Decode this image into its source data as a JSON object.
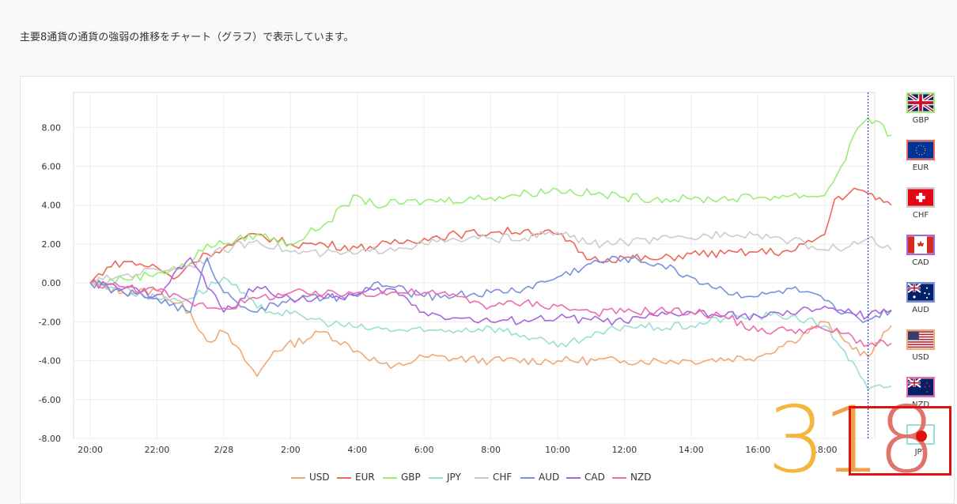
{
  "intro_text": "主要8通貨の通貨の強弱の推移をチャート（グラフ）で表示しています。",
  "chart_data": {
    "type": "line",
    "title": "",
    "xlabel": "",
    "ylabel": "",
    "x_ticks": [
      "20:00",
      "22:00",
      "2/28",
      "2:00",
      "4:00",
      "6:00",
      "8:00",
      "10:00",
      "12:00",
      "14:00",
      "16:00",
      "18:00"
    ],
    "y_ticks": [
      "8.00",
      "6.00",
      "4.00",
      "2.00",
      "0.00",
      "-2.00",
      "-4.00",
      "-6.00",
      "-8.00"
    ],
    "ylim": [
      -8,
      9.8
    ],
    "x_range_hours": [
      -0.5,
      23.5
    ],
    "current_time_marker_hour": 23.3,
    "grid": true,
    "legend_position": "bottom",
    "series": [
      {
        "name": "USD",
        "color": "#f0a875",
        "points": [
          [
            0,
            0
          ],
          [
            1,
            -0.5
          ],
          [
            2,
            -0.4
          ],
          [
            3,
            -1.5
          ],
          [
            3.5,
            -3.0
          ],
          [
            4,
            -2.5
          ],
          [
            5,
            -4.8
          ],
          [
            5.5,
            -3.5
          ],
          [
            7,
            -2.5
          ],
          [
            8,
            -3.5
          ],
          [
            9,
            -4.4
          ],
          [
            10,
            -3.8
          ],
          [
            12,
            -4.0
          ],
          [
            14,
            -4.0
          ],
          [
            16,
            -4.0
          ],
          [
            18,
            -4.0
          ],
          [
            20,
            -3.8
          ],
          [
            21,
            -3.0
          ],
          [
            22,
            -2.0
          ],
          [
            22.6,
            -3.0
          ],
          [
            23.3,
            -3.8
          ],
          [
            24,
            -2.2
          ]
        ]
      },
      {
        "name": "EUR",
        "color": "#ee6655",
        "points": [
          [
            0,
            0
          ],
          [
            0.5,
            0.8
          ],
          [
            1,
            1.1
          ],
          [
            2,
            0.8
          ],
          [
            2.5,
            0.2
          ],
          [
            3,
            1.0
          ],
          [
            3.5,
            1.5
          ],
          [
            4,
            1.8
          ],
          [
            5,
            2.5
          ],
          [
            6,
            2.0
          ],
          [
            7,
            2.0
          ],
          [
            8,
            1.8
          ],
          [
            9,
            2.0
          ],
          [
            10,
            2.3
          ],
          [
            11,
            2.5
          ],
          [
            12,
            2.6
          ],
          [
            13,
            2.7
          ],
          [
            14,
            2.5
          ],
          [
            15,
            1.2
          ],
          [
            16,
            1.3
          ],
          [
            17,
            1.2
          ],
          [
            18,
            1.5
          ],
          [
            19,
            1.5
          ],
          [
            20,
            1.6
          ],
          [
            21,
            1.6
          ],
          [
            22,
            2.5
          ],
          [
            22.3,
            4.3
          ],
          [
            23,
            4.8
          ],
          [
            23.3,
            4.6
          ],
          [
            24,
            4.0
          ]
        ]
      },
      {
        "name": "GBP",
        "color": "#99ee77",
        "points": [
          [
            0,
            0
          ],
          [
            1,
            0.2
          ],
          [
            2,
            0.5
          ],
          [
            3,
            1.0
          ],
          [
            3.5,
            2.0
          ],
          [
            4,
            2.0
          ],
          [
            5,
            2.5
          ],
          [
            6,
            2.0
          ],
          [
            7,
            3.0
          ],
          [
            8,
            4.5
          ],
          [
            8.5,
            4.0
          ],
          [
            10,
            4.2
          ],
          [
            12,
            4.4
          ],
          [
            14,
            4.8
          ],
          [
            16,
            4.4
          ],
          [
            18,
            4.3
          ],
          [
            20,
            4.4
          ],
          [
            21,
            4.5
          ],
          [
            22,
            4.5
          ],
          [
            22.5,
            6.0
          ],
          [
            23,
            8.0
          ],
          [
            23.3,
            8.5
          ],
          [
            24,
            7.6
          ]
        ]
      },
      {
        "name": "JPY",
        "color": "#99dfd4",
        "points": [
          [
            0,
            0
          ],
          [
            1,
            -0.3
          ],
          [
            2,
            -0.8
          ],
          [
            3,
            -0.8
          ],
          [
            4,
            0.3
          ],
          [
            5,
            -1.3
          ],
          [
            6,
            -1.6
          ],
          [
            7,
            -2.0
          ],
          [
            8,
            -2.3
          ],
          [
            10,
            -2.5
          ],
          [
            12,
            -2.3
          ],
          [
            13,
            -2.7
          ],
          [
            14,
            -3.3
          ],
          [
            15,
            -2.8
          ],
          [
            16,
            -2.2
          ],
          [
            17,
            -2.3
          ],
          [
            18,
            -2.2
          ],
          [
            19,
            -1.8
          ],
          [
            20,
            -1.7
          ],
          [
            21,
            -1.7
          ],
          [
            22,
            -2.2
          ],
          [
            22.6,
            -3.5
          ],
          [
            23.3,
            -5.5
          ],
          [
            24,
            -5.3
          ]
        ]
      },
      {
        "name": "CHF",
        "color": "#cccccc",
        "points": [
          [
            0,
            0
          ],
          [
            1,
            0.4
          ],
          [
            2,
            0.7
          ],
          [
            3,
            0.9
          ],
          [
            4,
            1.7
          ],
          [
            5,
            2.2
          ],
          [
            6,
            1.6
          ],
          [
            7,
            1.5
          ],
          [
            8,
            1.5
          ],
          [
            9,
            1.8
          ],
          [
            10,
            2.0
          ],
          [
            11,
            2.2
          ],
          [
            12,
            2.3
          ],
          [
            13,
            2.3
          ],
          [
            14,
            2.6
          ],
          [
            15,
            2.0
          ],
          [
            16,
            2.1
          ],
          [
            17,
            2.2
          ],
          [
            18,
            2.3
          ],
          [
            19,
            2.6
          ],
          [
            20,
            2.5
          ],
          [
            21,
            2.2
          ],
          [
            22,
            1.7
          ],
          [
            23,
            2.0
          ],
          [
            23.3,
            2.3
          ],
          [
            24,
            1.7
          ]
        ]
      },
      {
        "name": "AUD",
        "color": "#7b8fdc",
        "points": [
          [
            0,
            0
          ],
          [
            1,
            -0.5
          ],
          [
            2,
            -0.8
          ],
          [
            3,
            -1.5
          ],
          [
            3.5,
            1.3
          ],
          [
            4,
            -0.5
          ],
          [
            5,
            -1.5
          ],
          [
            6,
            -0.8
          ],
          [
            7,
            -0.8
          ],
          [
            8,
            -0.7
          ],
          [
            8.5,
            0.0
          ],
          [
            9,
            -0.2
          ],
          [
            10,
            -0.7
          ],
          [
            11,
            -0.6
          ],
          [
            12,
            -0.5
          ],
          [
            13,
            -0.3
          ],
          [
            14,
            0.3
          ],
          [
            15,
            1.0
          ],
          [
            16,
            1.3
          ],
          [
            17,
            1.0
          ],
          [
            18,
            0.3
          ],
          [
            19,
            -0.4
          ],
          [
            20,
            -0.7
          ],
          [
            21,
            -0.3
          ],
          [
            22,
            -0.9
          ],
          [
            22.5,
            -1.6
          ],
          [
            23,
            -1.8
          ],
          [
            23.3,
            -1.9
          ],
          [
            24,
            -1.4
          ]
        ]
      },
      {
        "name": "CAD",
        "color": "#a866dd",
        "points": [
          [
            0,
            0
          ],
          [
            1,
            -0.3
          ],
          [
            2,
            -0.6
          ],
          [
            3,
            1.3
          ],
          [
            4,
            -1.5
          ],
          [
            5,
            -0.2
          ],
          [
            6,
            -0.8
          ],
          [
            7,
            -0.8
          ],
          [
            8,
            -0.6
          ],
          [
            9,
            -0.3
          ],
          [
            10,
            -1.5
          ],
          [
            11,
            -1.8
          ],
          [
            12,
            -2.0
          ],
          [
            13,
            -1.9
          ],
          [
            14,
            -1.8
          ],
          [
            15,
            -1.9
          ],
          [
            16,
            -2.0
          ],
          [
            17,
            -1.7
          ],
          [
            18,
            -1.5
          ],
          [
            19,
            -1.7
          ],
          [
            20,
            -1.7
          ],
          [
            21,
            -1.6
          ],
          [
            22,
            -1.2
          ],
          [
            22.6,
            -1.5
          ],
          [
            23.3,
            -1.7
          ],
          [
            24,
            -1.4
          ]
        ]
      },
      {
        "name": "NZD",
        "color": "#ee6bb0",
        "points": [
          [
            0,
            0
          ],
          [
            1,
            -0.2
          ],
          [
            2,
            -0.4
          ],
          [
            3,
            -1.0
          ],
          [
            4,
            -1.3
          ],
          [
            5,
            -0.8
          ],
          [
            6,
            -0.5
          ],
          [
            7,
            -0.6
          ],
          [
            8,
            -0.5
          ],
          [
            9,
            -0.5
          ],
          [
            10,
            -0.5
          ],
          [
            11,
            -0.7
          ],
          [
            12,
            -1.2
          ],
          [
            13,
            -1.0
          ],
          [
            14,
            -1.2
          ],
          [
            15,
            -1.5
          ],
          [
            16,
            -1.5
          ],
          [
            17,
            -1.4
          ],
          [
            18,
            -1.5
          ],
          [
            19,
            -1.7
          ],
          [
            20,
            -2.5
          ],
          [
            21,
            -2.4
          ],
          [
            22,
            -2.4
          ],
          [
            22.6,
            -2.6
          ],
          [
            23.3,
            -3.2
          ],
          [
            24,
            -3.1
          ]
        ]
      }
    ]
  },
  "flags": [
    {
      "code": "GBP",
      "name": "uk-flag-icon",
      "border": "#99ee77"
    },
    {
      "code": "EUR",
      "name": "eu-flag-icon",
      "border": "#ee6655"
    },
    {
      "code": "CHF",
      "name": "swiss-flag-icon",
      "border": "#cccccc"
    },
    {
      "code": "CAD",
      "name": "canada-flag-icon",
      "border": "#a866dd"
    },
    {
      "code": "AUD",
      "name": "australia-flag-icon",
      "border": "#7b8fdc"
    },
    {
      "code": "USD",
      "name": "us-flag-icon",
      "border": "#f0a875"
    },
    {
      "code": "NZD",
      "name": "new-zealand-flag-icon",
      "border": "#ee6bb0"
    },
    {
      "code": "JPY",
      "name": "japan-flag-icon",
      "border": "#99dfd4"
    }
  ],
  "overlay": {
    "number": "318",
    "d1": "3",
    "d2": "1",
    "d3": "8"
  }
}
